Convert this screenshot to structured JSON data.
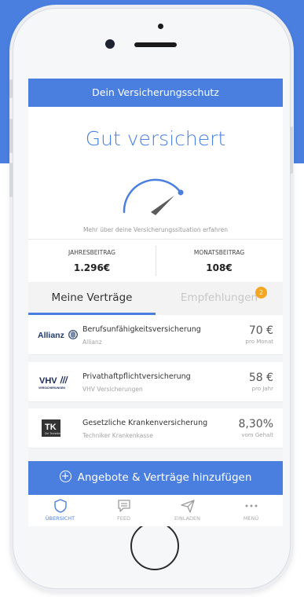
{
  "header": {
    "title": "Dein Versicherungsschutz"
  },
  "hero": {
    "title": "Gut versichert",
    "link_text": "Mehr über deine Versicherungssituation erfahren"
  },
  "stats": [
    {
      "label": "JAHRESBEITRAG",
      "value": "1.296€"
    },
    {
      "label": "MONATSBEITRAG",
      "value": "108€"
    }
  ],
  "tabs": {
    "active": "Meine Verträge",
    "inactive": "Empfehlungen",
    "badge": "2"
  },
  "contracts": [
    {
      "logo": "Allianz",
      "title": "Berufsunfähigkeitsversicherung",
      "company": "Allianz",
      "amount": "70 €",
      "period": "pro Monat"
    },
    {
      "logo": "VHV VERSICHERUNGEN",
      "title": "Privathaftpflichtversicherung",
      "company": "VHV Versicherungen",
      "amount": "58 €",
      "period": "pro Jahr"
    },
    {
      "logo": "TK",
      "title": "Gesetzliche Krankenversicherung",
      "company": "Techniker Krankenkasse",
      "amount": "8,30%",
      "period": "vom Gehalt"
    }
  ],
  "cta": {
    "label": "Angebote & Verträge hinzufügen",
    "icon": "plus-circle-icon"
  },
  "nav": [
    {
      "label": "ÜBERSICHT",
      "icon": "shield-icon",
      "active": true
    },
    {
      "label": "FEED",
      "icon": "chat-icon"
    },
    {
      "label": "EINLADEN",
      "icon": "paper-plane-icon"
    },
    {
      "label": "MENÜ",
      "icon": "more-dots-icon"
    }
  ],
  "colors": {
    "primary": "#4a7fe0",
    "badge": "#f4a623",
    "gauge_needle": "#555555"
  }
}
